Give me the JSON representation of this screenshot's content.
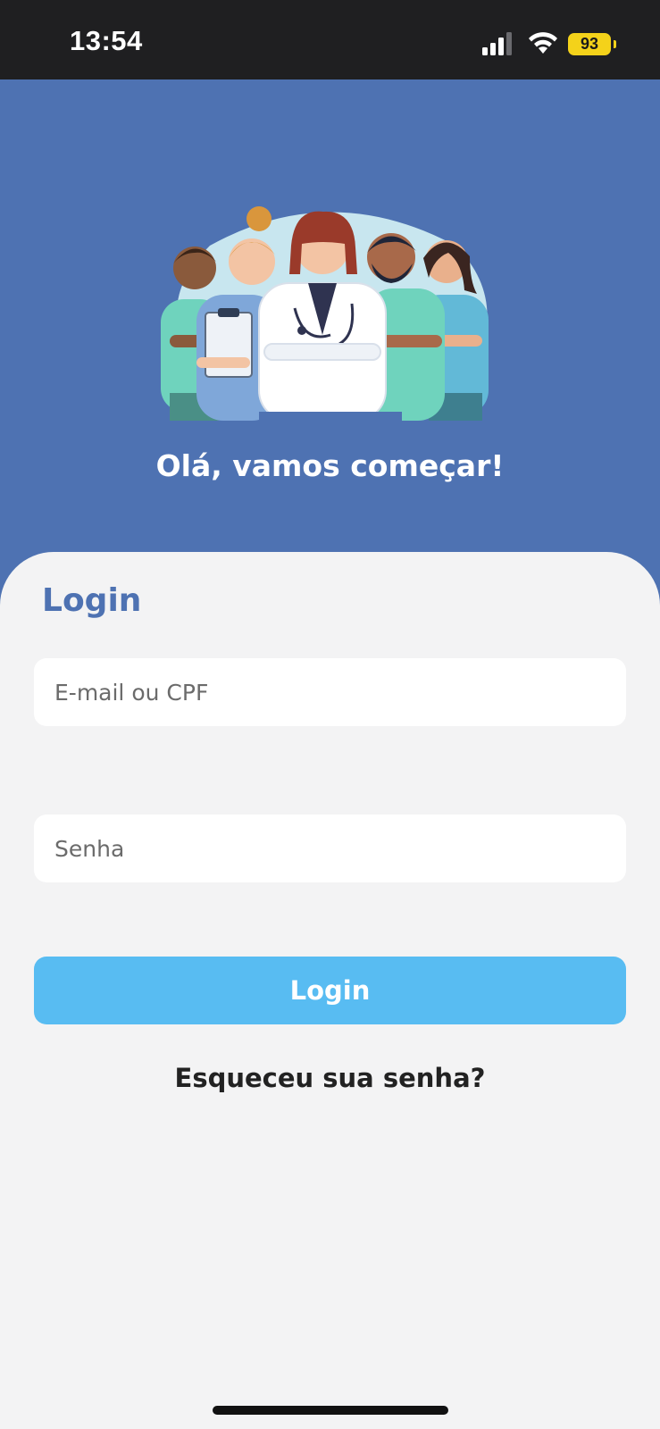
{
  "status_bar": {
    "time": "13:54",
    "battery": "93"
  },
  "hero": {
    "title": "Olá, vamos começar!"
  },
  "login": {
    "heading": "Login",
    "email_placeholder": "E-mail ou CPF",
    "password_placeholder": "Senha",
    "button_label": "Login",
    "forgot_label": "Esqueceu sua senha?"
  },
  "colors": {
    "primary": "#4e72b2",
    "accent": "#58bcf2",
    "card_bg": "#f3f3f4",
    "status_bar": "#1f1f21",
    "battery": "#f4d21a"
  },
  "icons": [
    "signal-icon",
    "wifi-icon",
    "battery-icon",
    "medical-team-illustration"
  ]
}
